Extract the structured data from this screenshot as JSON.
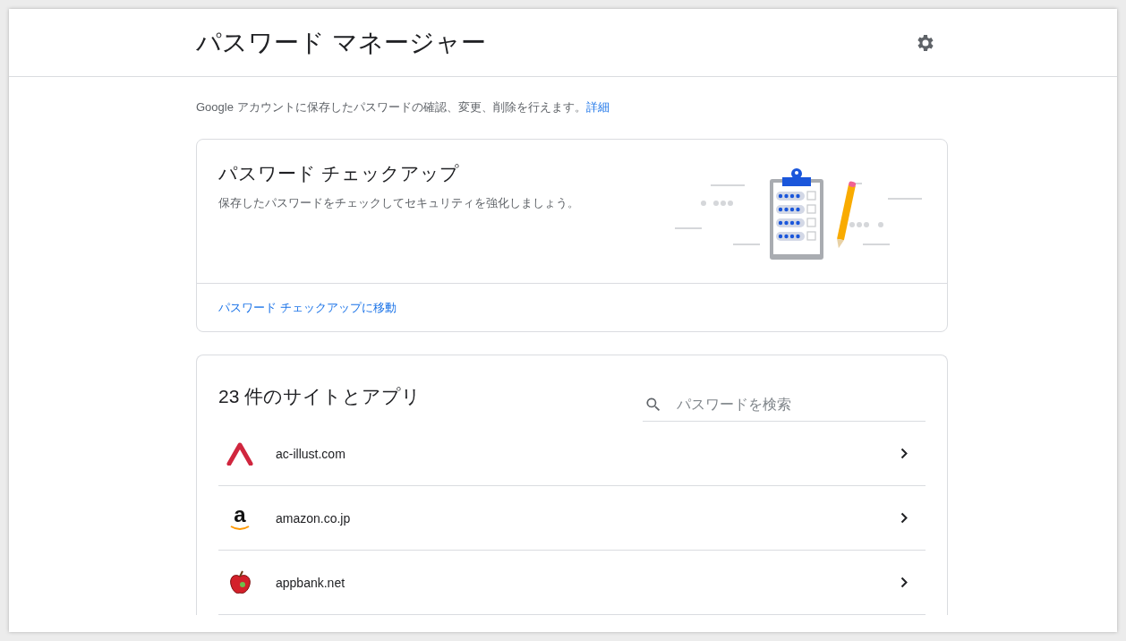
{
  "header": {
    "title": "パスワード マネージャー"
  },
  "intro": {
    "text": "Google アカウントに保存したパスワードの確認、変更、削除を行えます。",
    "link": "詳細"
  },
  "checkup": {
    "title": "パスワード チェックアップ",
    "description": "保存したパスワードをチェックしてセキュリティを強化しましょう。",
    "action": "パスワード チェックアップに移動"
  },
  "sites": {
    "title": "23 件のサイトとアプリ",
    "search": {
      "placeholder": "パスワードを検索"
    },
    "items": [
      {
        "name": "ac-illust.com",
        "kind": "caret"
      },
      {
        "name": "amazon.co.jp",
        "kind": "letter",
        "letter": "a"
      },
      {
        "name": "appbank.net",
        "kind": "apple"
      }
    ]
  }
}
